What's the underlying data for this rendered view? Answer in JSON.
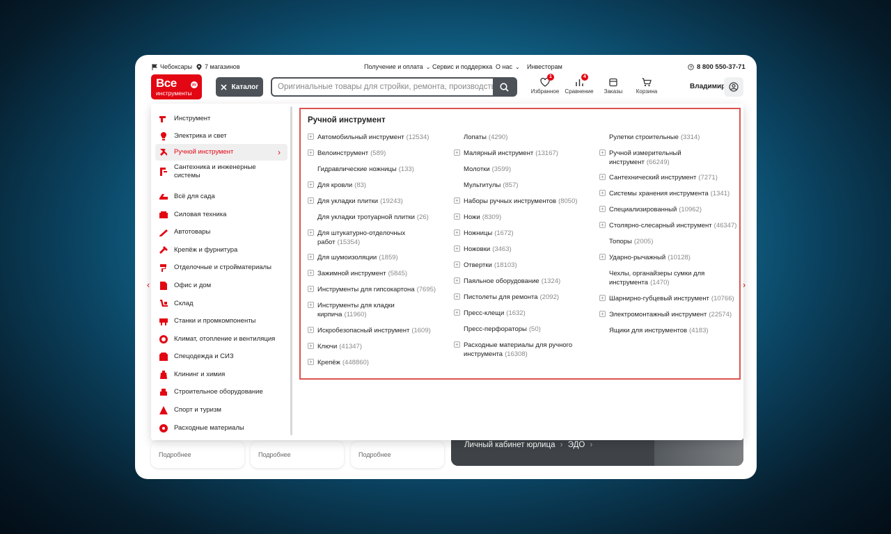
{
  "topbar": {
    "city": "Чебоксары",
    "stores": "7 магазинов",
    "nav": [
      "Получение и оплата",
      "Сервис и поддержка",
      "О нас",
      "Инвесторам"
    ],
    "phone": "8 800 550-37-71"
  },
  "logo": {
    "line1": "Все",
    "line2": "инструменты",
    "badge": "ру"
  },
  "catalog_button": {
    "label": "Каталог"
  },
  "search": {
    "placeholder": "Оригинальные товары для стройки, ремонта, производства"
  },
  "header_icons": [
    {
      "label": "Избранное",
      "badge": "1",
      "icon": "heart-icon"
    },
    {
      "label": "Сравнение",
      "badge": "4",
      "icon": "compare-icon"
    },
    {
      "label": "Заказы",
      "badge": "",
      "icon": "orders-icon"
    },
    {
      "label": "Корзина",
      "badge": "",
      "icon": "cart-icon"
    }
  ],
  "user": {
    "name": "Владимир"
  },
  "background": {
    "card_link": "Подробнее",
    "banner_links": [
      "Личный кабинет юрлица",
      "ЭДО"
    ]
  },
  "sidebar": {
    "items": [
      {
        "label": "Инструмент",
        "icon": "drill-icon"
      },
      {
        "label": "Электрика и свет",
        "icon": "bulb-icon"
      },
      {
        "label": "Ручной инструмент",
        "icon": "wrench-icon",
        "active": true
      },
      {
        "label": "Сантехника и инженерные системы",
        "icon": "faucet-icon"
      },
      {
        "label": "Всё для сада",
        "icon": "mower-icon"
      },
      {
        "label": "Силовая техника",
        "icon": "generator-icon"
      },
      {
        "label": "Автотовары",
        "icon": "car-jack-icon"
      },
      {
        "label": "Крепёж и фурнитура",
        "icon": "screw-icon"
      },
      {
        "label": "Отделочные и стройматериалы",
        "icon": "roller-icon"
      },
      {
        "label": "Офис и дом",
        "icon": "office-icon"
      },
      {
        "label": "Склад",
        "icon": "cart-dolly-icon"
      },
      {
        "label": "Станки и промкомпоненты",
        "icon": "machine-icon"
      },
      {
        "label": "Климат, отопление и вентиляция",
        "icon": "climate-icon"
      },
      {
        "label": "Спецодежда и СИЗ",
        "icon": "workwear-icon"
      },
      {
        "label": "Клининг и химия",
        "icon": "cleaning-icon"
      },
      {
        "label": "Строительное оборудование",
        "icon": "equipment-icon"
      },
      {
        "label": "Спорт и туризм",
        "icon": "tent-icon"
      },
      {
        "label": "Расходные материалы",
        "icon": "disc-icon"
      }
    ]
  },
  "content": {
    "title": "Ручной инструмент",
    "columns": [
      [
        {
          "name": "Автомобильный инструмент",
          "count": "(12534)",
          "expandable": true
        },
        {
          "name": "Велоинструмент",
          "count": "(589)",
          "expandable": true
        },
        {
          "name": "Гидравлические ножницы",
          "count": "(133)",
          "expandable": false
        },
        {
          "name": "Для кровли",
          "count": "(83)",
          "expandable": true
        },
        {
          "name": "Для укладки плитки",
          "count": "(19243)",
          "expandable": true
        },
        {
          "name": "Для укладки тротуарной плитки",
          "count": "(26)",
          "expandable": false
        },
        {
          "name": "Для штукатурно-отделочных работ",
          "count": "(15354)",
          "expandable": true
        },
        {
          "name": "Для шумоизоляции",
          "count": "(1859)",
          "expandable": true
        },
        {
          "name": "Зажимной инструмент",
          "count": "(5845)",
          "expandable": true
        },
        {
          "name": "Инструменты для гипсокартона",
          "count": "(7695)",
          "expandable": true
        },
        {
          "name": "Инструменты для кладки кирпича",
          "count": "(11960)",
          "expandable": true
        },
        {
          "name": "Искробезопасный инструмент",
          "count": "(1609)",
          "expandable": true
        },
        {
          "name": "Ключи",
          "count": "(41347)",
          "expandable": true
        },
        {
          "name": "Крепёж",
          "count": "(448860)",
          "expandable": true
        }
      ],
      [
        {
          "name": "Лопаты",
          "count": "(4290)",
          "expandable": false
        },
        {
          "name": "Малярный инструмент",
          "count": "(13167)",
          "expandable": true
        },
        {
          "name": "Молотки",
          "count": "(3599)",
          "expandable": false
        },
        {
          "name": "Мультитулы",
          "count": "(857)",
          "expandable": false
        },
        {
          "name": "Наборы ручных инструментов",
          "count": "(8050)",
          "expandable": true
        },
        {
          "name": "Ножи",
          "count": "(8309)",
          "expandable": true
        },
        {
          "name": "Ножницы",
          "count": "(1672)",
          "expandable": true
        },
        {
          "name": "Ножовки",
          "count": "(3463)",
          "expandable": true
        },
        {
          "name": "Отвертки",
          "count": "(18103)",
          "expandable": true
        },
        {
          "name": "Паяльное оборудование",
          "count": "(1324)",
          "expandable": true
        },
        {
          "name": "Пистолеты для ремонта",
          "count": "(2092)",
          "expandable": true
        },
        {
          "name": "Пресс-клещи",
          "count": "(1632)",
          "expandable": true
        },
        {
          "name": "Пресс-перфораторы",
          "count": "(50)",
          "expandable": false
        },
        {
          "name": "Расходные материалы для ручного инструмента",
          "count": "(16308)",
          "expandable": true
        }
      ],
      [
        {
          "name": "Рулетки строительные",
          "count": "(3314)",
          "expandable": false
        },
        {
          "name": "Ручной измерительный инструмент",
          "count": "(66249)",
          "expandable": true
        },
        {
          "name": "Сантехнический инструмент",
          "count": "(7271)",
          "expandable": true
        },
        {
          "name": "Системы хранения инструмента",
          "count": "(1341)",
          "expandable": true
        },
        {
          "name": "Специализированный",
          "count": "(10962)",
          "expandable": true
        },
        {
          "name": "Столярно-слесарный инструмент",
          "count": "(46347)",
          "expandable": true
        },
        {
          "name": "Топоры",
          "count": "(2005)",
          "expandable": false
        },
        {
          "name": "Ударно-рычажный",
          "count": "(10128)",
          "expandable": true
        },
        {
          "name": "Чехлы, органайзеры сумки для инструмента",
          "count": "(1470)",
          "expandable": false
        },
        {
          "name": "Шарнирно-губцевый инструмент",
          "count": "(10766)",
          "expandable": true
        },
        {
          "name": "Электромонтажный инструмент",
          "count": "(22574)",
          "expandable": true
        },
        {
          "name": "Ящики для инструментов",
          "count": "(4183)",
          "expandable": false
        }
      ]
    ]
  },
  "colors": {
    "brand": "#e30613",
    "dark": "#4c5257",
    "highlight_border": "#d9534f"
  }
}
